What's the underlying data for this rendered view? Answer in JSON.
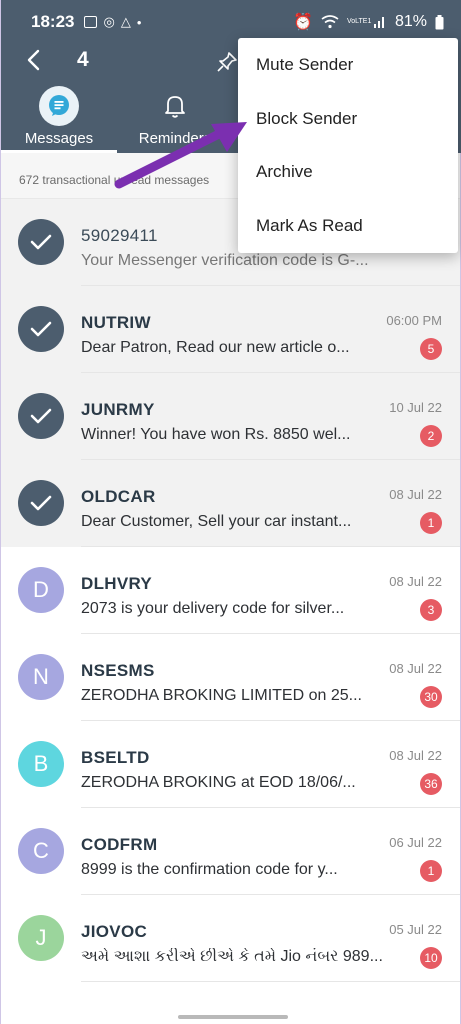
{
  "status_bar": {
    "time": "18:23",
    "network_label": "VoLTE1",
    "battery": "81%"
  },
  "toolbar": {
    "count": "4"
  },
  "tabs": [
    {
      "label": "Messages",
      "active": true,
      "icon": "chat-bubble-icon"
    },
    {
      "label": "Reminders",
      "active": false,
      "icon": "bell-icon"
    }
  ],
  "summary": {
    "text": "672  transactional unread messages"
  },
  "menu": {
    "items": [
      "Mute Sender",
      "Block Sender",
      "Archive",
      "Mark As Read"
    ]
  },
  "conversations": [
    {
      "sender": "59029411",
      "snippet": "Your Messenger verification code is G-...",
      "time": "",
      "badge": "",
      "selected": true,
      "avatar": "check"
    },
    {
      "sender": "NUTRIW",
      "snippet": "Dear Patron, Read our new article o...",
      "time": "06:00 PM",
      "badge": "5",
      "selected": true,
      "avatar": "check"
    },
    {
      "sender": "JUNRMY",
      "snippet": "Winner! You have won Rs. 8850 wel...",
      "time": "10 Jul 22",
      "badge": "2",
      "selected": true,
      "avatar": "check"
    },
    {
      "sender": "OLDCAR",
      "snippet": "Dear Customer, Sell your car instant...",
      "time": "08 Jul 22",
      "badge": "1",
      "selected": true,
      "avatar": "check"
    },
    {
      "sender": "DLHVRY",
      "snippet": "2073 is your delivery code for silver...",
      "time": "08 Jul 22",
      "badge": "3",
      "selected": false,
      "avatar": "D",
      "avatar_color": "#a6a7e0"
    },
    {
      "sender": "NSESMS",
      "snippet": "ZERODHA BROKING LIMITED on 25...",
      "time": "08 Jul 22",
      "badge": "30",
      "selected": false,
      "avatar": "N",
      "avatar_color": "#a6a7e0"
    },
    {
      "sender": "BSELTD",
      "snippet": "ZERODHA BROKING at EOD 18/06/...",
      "time": "08 Jul 22",
      "badge": "36",
      "selected": false,
      "avatar": "B",
      "avatar_color": "#5ed6df"
    },
    {
      "sender": "CODFRM",
      "snippet": "8999 is the confirmation code for y...",
      "time": "06 Jul 22",
      "badge": "1",
      "selected": false,
      "avatar": "C",
      "avatar_color": "#a6a7e0"
    },
    {
      "sender": "JIOVOC",
      "snippet": "અમે આશા કરીએ છીએ કે તમે Jio નંબર 989...",
      "time": "05 Jul 22",
      "badge": "10",
      "selected": false,
      "avatar": "J",
      "avatar_color": "#9bd59c"
    }
  ],
  "colors": {
    "header": "#4c5d6e",
    "badge": "#e65b63",
    "arrow": "#7b2fb0"
  }
}
